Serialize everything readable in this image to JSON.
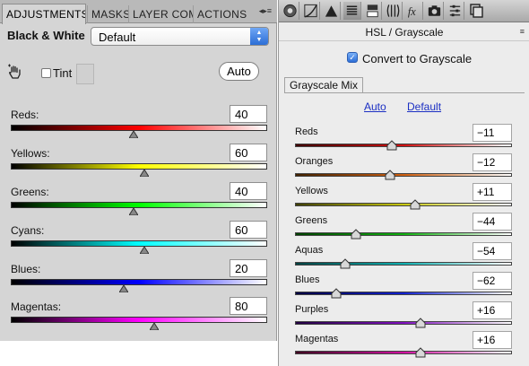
{
  "left_panel": {
    "tabs": [
      "ADJUSTMENTS",
      "MASKS",
      "LAYER COM",
      "ACTIONS"
    ],
    "panel_menu_icon": "menu-icon",
    "adjustment_title": "Black & White",
    "preset": "Default",
    "tint_label": "Tint",
    "tint_checked": false,
    "auto_label": "Auto",
    "sliders": [
      {
        "label": "Reds:",
        "value": "40",
        "min": -200,
        "max": 300,
        "colors": [
          "#000000",
          "#ff0000",
          "#ffffff"
        ]
      },
      {
        "label": "Yellows:",
        "value": "60",
        "min": -200,
        "max": 300,
        "colors": [
          "#000000",
          "#ffff00",
          "#ffffff"
        ]
      },
      {
        "label": "Greens:",
        "value": "40",
        "min": -200,
        "max": 300,
        "colors": [
          "#000000",
          "#00ff00",
          "#ffffff"
        ]
      },
      {
        "label": "Cyans:",
        "value": "60",
        "min": -200,
        "max": 300,
        "colors": [
          "#000000",
          "#00ffff",
          "#ffffff"
        ]
      },
      {
        "label": "Blues:",
        "value": "20",
        "min": -200,
        "max": 300,
        "colors": [
          "#000000",
          "#0000ff",
          "#ffffff"
        ]
      },
      {
        "label": "Magentas:",
        "value": "80",
        "min": -200,
        "max": 300,
        "colors": [
          "#000000",
          "#ff00ff",
          "#ffffff"
        ]
      }
    ]
  },
  "right_panel": {
    "toolbar_icons": [
      "aperture-icon",
      "curve-icon",
      "sharpen-icon",
      "hsl-icon",
      "split-tone-icon",
      "lens-icon",
      "fx-icon",
      "camera-icon",
      "presets-icon",
      "snapshots-icon"
    ],
    "title": "HSL / Grayscale",
    "panel_menu_icon": "menu-icon",
    "convert_label": "Convert to Grayscale",
    "convert_checked": true,
    "mix_tab": "Grayscale Mix",
    "auto_link": "Auto",
    "default_link": "Default",
    "sliders": [
      {
        "label": "Reds",
        "value": "−11",
        "num": -11,
        "colors": [
          "#400000",
          "#d01010",
          "#ffffff"
        ]
      },
      {
        "label": "Oranges",
        "value": "−12",
        "num": -12,
        "colors": [
          "#402000",
          "#d06010",
          "#ffffff"
        ]
      },
      {
        "label": "Yellows",
        "value": "+11",
        "num": 11,
        "colors": [
          "#404000",
          "#c8c810",
          "#ffffff"
        ]
      },
      {
        "label": "Greens",
        "value": "−44",
        "num": -44,
        "colors": [
          "#004000",
          "#10b010",
          "#ffffff"
        ]
      },
      {
        "label": "Aquas",
        "value": "−54",
        "num": -54,
        "colors": [
          "#004040",
          "#10b0b0",
          "#ffffff"
        ]
      },
      {
        "label": "Blues",
        "value": "−62",
        "num": -62,
        "colors": [
          "#000040",
          "#1020d0",
          "#ffffff"
        ]
      },
      {
        "label": "Purples",
        "value": "+16",
        "num": 16,
        "colors": [
          "#200040",
          "#8010c0",
          "#ffffff"
        ]
      },
      {
        "label": "Magentas",
        "value": "+16",
        "num": 16,
        "colors": [
          "#400020",
          "#d010a0",
          "#ffffff"
        ]
      }
    ]
  }
}
